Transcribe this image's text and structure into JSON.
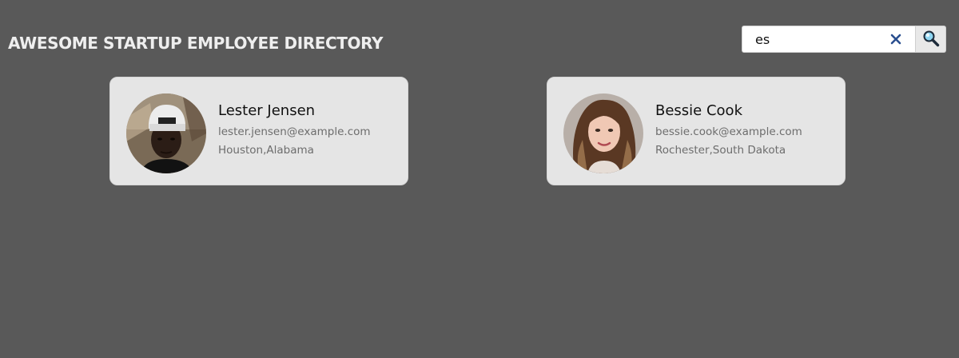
{
  "header": {
    "title": "AWESOME STARTUP EMPLOYEE DIRECTORY"
  },
  "search": {
    "value": "es",
    "clear_icon": "close-icon",
    "search_icon": "magnifier-icon"
  },
  "colors": {
    "background": "#595959",
    "card_background": "#e5e5e5",
    "title_text": "#eeeeee",
    "secondary_text": "#6d6d6d",
    "clear_icon": "#2a4f8f",
    "search_icon_lens": "#39a9d8"
  },
  "employees": [
    {
      "name": "Lester Jensen",
      "email": "lester.jensen@example.com",
      "location": "Houston,Alabama",
      "avatar": "avatar-photo"
    },
    {
      "name": "Bessie Cook",
      "email": "bessie.cook@example.com",
      "location": "Rochester,South Dakota",
      "avatar": "avatar-photo"
    }
  ]
}
